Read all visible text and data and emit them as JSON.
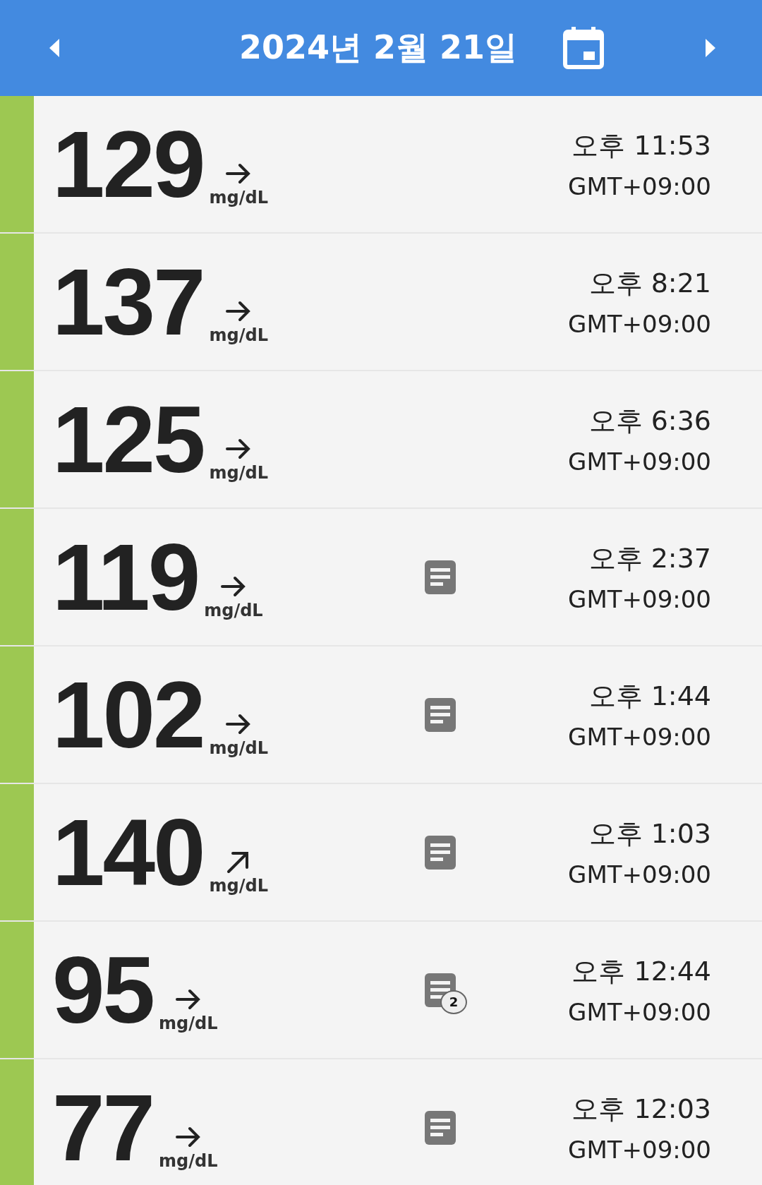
{
  "header": {
    "title": "2024년 2월 21일"
  },
  "readings": [
    {
      "value": "129",
      "trend_up": false,
      "unit": "mg/dL",
      "note": false,
      "time": "오후 11:53",
      "timezone": "GMT+09:00",
      "color": "#9dc852"
    },
    {
      "value": "137",
      "trend_up": false,
      "unit": "mg/dL",
      "note": false,
      "time": "오후 8:21",
      "timezone": "GMT+09:00",
      "color": "#9dc852"
    },
    {
      "value": "125",
      "trend_up": false,
      "unit": "mg/dL",
      "note": false,
      "time": "오후 6:36",
      "timezone": "GMT+09:00",
      "color": "#9dc852"
    },
    {
      "value": "119",
      "trend_up": false,
      "unit": "mg/dL",
      "note": true,
      "time": "오후 2:37",
      "timezone": "GMT+09:00",
      "color": "#9dc852"
    },
    {
      "value": "102",
      "trend_up": false,
      "unit": "mg/dL",
      "note": true,
      "time": "오후 1:44",
      "timezone": "GMT+09:00",
      "color": "#9dc852"
    },
    {
      "value": "140",
      "trend_up": true,
      "unit": "mg/dL",
      "note": true,
      "time": "오후 1:03",
      "timezone": "GMT+09:00",
      "color": "#9dc852"
    },
    {
      "value": "95",
      "trend_up": false,
      "unit": "mg/dL",
      "note": true,
      "note_count": "2",
      "time": "오후 12:44",
      "timezone": "GMT+09:00",
      "color": "#9dc852"
    },
    {
      "value": "77",
      "trend_up": false,
      "unit": "mg/dL",
      "note": true,
      "time": "오후 12:03",
      "timezone": "GMT+09:00",
      "color": "#9dc852"
    }
  ]
}
